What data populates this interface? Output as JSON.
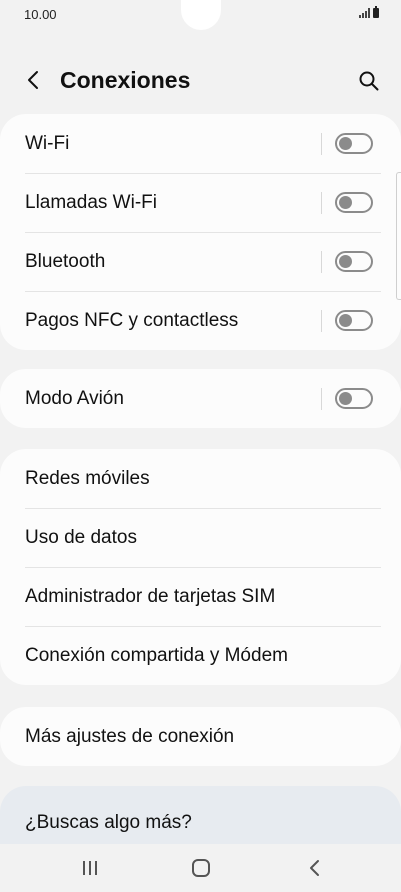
{
  "status_bar": {
    "time": "10.00"
  },
  "header": {
    "title": "Conexiones"
  },
  "groups": [
    {
      "items": [
        {
          "label": "Wi-Fi",
          "toggle": true,
          "on": false
        },
        {
          "label": "Llamadas Wi-Fi",
          "toggle": true,
          "on": false
        },
        {
          "label": "Bluetooth",
          "toggle": true,
          "on": false
        },
        {
          "label": "Pagos NFC y contactless",
          "toggle": true,
          "on": false
        }
      ]
    },
    {
      "items": [
        {
          "label": "Modo Avión",
          "toggle": true,
          "on": false
        }
      ]
    },
    {
      "items": [
        {
          "label": "Redes móviles",
          "toggle": false
        },
        {
          "label": "Uso de datos",
          "toggle": false
        },
        {
          "label": "Administrador de tarjetas SIM",
          "toggle": false
        },
        {
          "label": "Conexión compartida y Módem",
          "toggle": false
        }
      ]
    },
    {
      "items": [
        {
          "label": "Más ajustes de conexión",
          "toggle": false
        }
      ]
    }
  ],
  "suggestion": {
    "text": "¿Buscas algo más?"
  },
  "colors": {
    "background": "#f2f2f2",
    "card": "#fcfcfc",
    "toggle_off": "#8b8b8b",
    "suggestion_bg": "#e7ebf0"
  },
  "icons": {
    "back": "chevron-left-icon",
    "search": "search-icon",
    "nav_recent": "recent-apps-icon",
    "nav_home": "home-icon",
    "nav_back": "back-icon"
  }
}
